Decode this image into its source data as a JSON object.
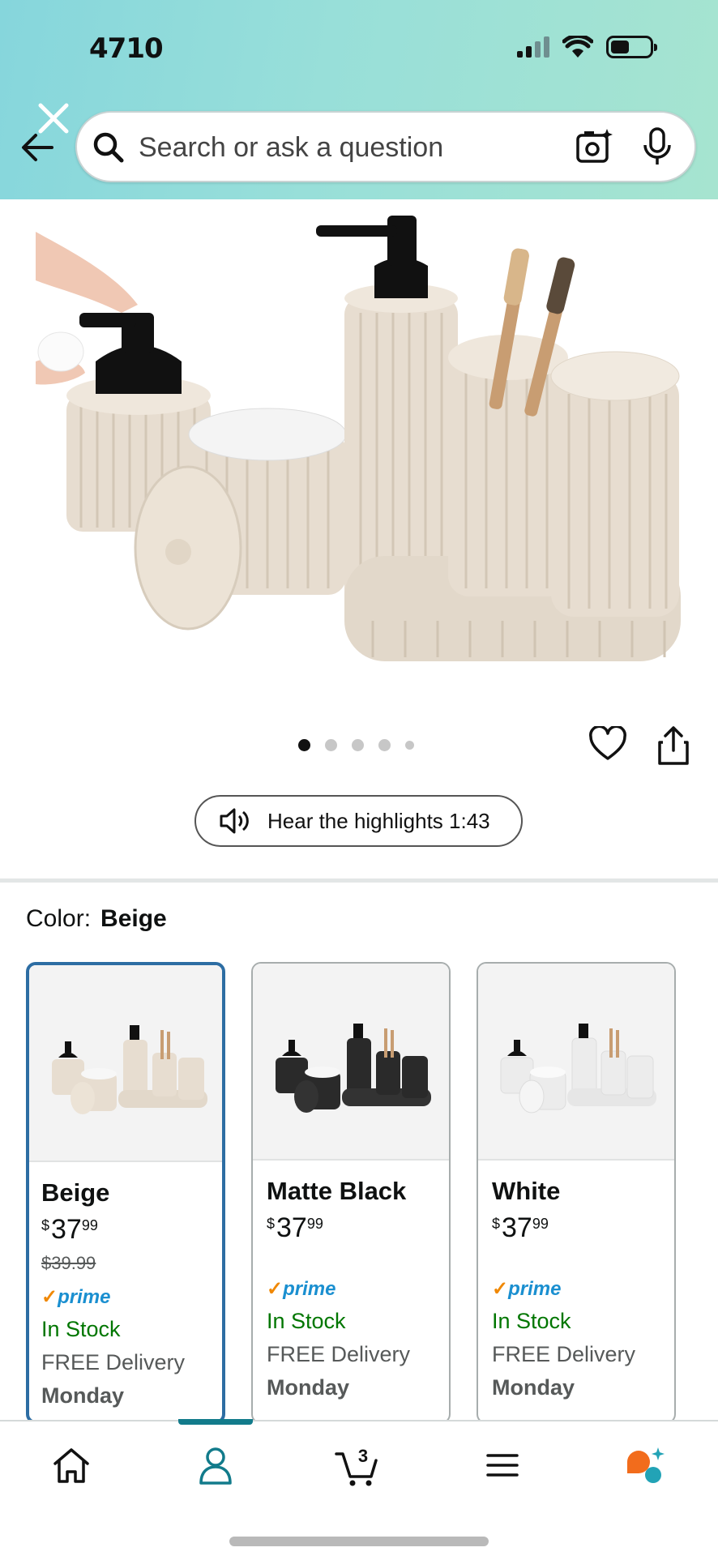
{
  "status_bar": {
    "time": "4710",
    "icons": [
      "signal-icon",
      "wifi-icon",
      "battery-icon"
    ]
  },
  "header": {
    "search": {
      "placeholder": "Search or ask a question"
    },
    "icons": [
      "close-icon",
      "back-arrow-icon",
      "search-icon",
      "camera-icon",
      "microphone-icon"
    ]
  },
  "product": {
    "image_alt": "bathroom accessory set",
    "carousel_dots": 5,
    "carousel_active": 1,
    "hear_highlights": "Hear the highlights 1:43"
  },
  "color": {
    "label": "Color:",
    "value": "Beige"
  },
  "swatches": [
    {
      "name": "Beige",
      "currency": "$",
      "price_whole": "37",
      "price_fraction": "99",
      "list_price": "$39.99",
      "prime": "prime",
      "stock": "In Stock",
      "delivery": "FREE Delivery",
      "day": "Monday",
      "selected": true,
      "color": "#e7ddd0"
    },
    {
      "name": "Matte Black",
      "currency": "$",
      "price_whole": "37",
      "price_fraction": "99",
      "list_price": "",
      "prime": "prime",
      "stock": "In Stock",
      "delivery": "FREE Delivery",
      "day": "Monday",
      "selected": false,
      "color": "#2a2a2a"
    },
    {
      "name": "White",
      "currency": "$",
      "price_whole": "37",
      "price_fraction": "99",
      "list_price": "",
      "prime": "prime",
      "stock": "In Stock",
      "delivery": "FREE Delivery",
      "day": "Monday",
      "selected": false,
      "color": "#f2f2f2"
    }
  ],
  "bottom_nav": {
    "items": [
      "home-icon",
      "account-icon",
      "cart-icon",
      "menu-icon",
      "rufus-icon"
    ],
    "cart_count": "3",
    "active": "account-icon"
  },
  "colors": {
    "accent": "#2d6da3",
    "prime_blue": "#1a8fd0",
    "stock_green": "#007600",
    "nav_active": "#127b8b"
  }
}
